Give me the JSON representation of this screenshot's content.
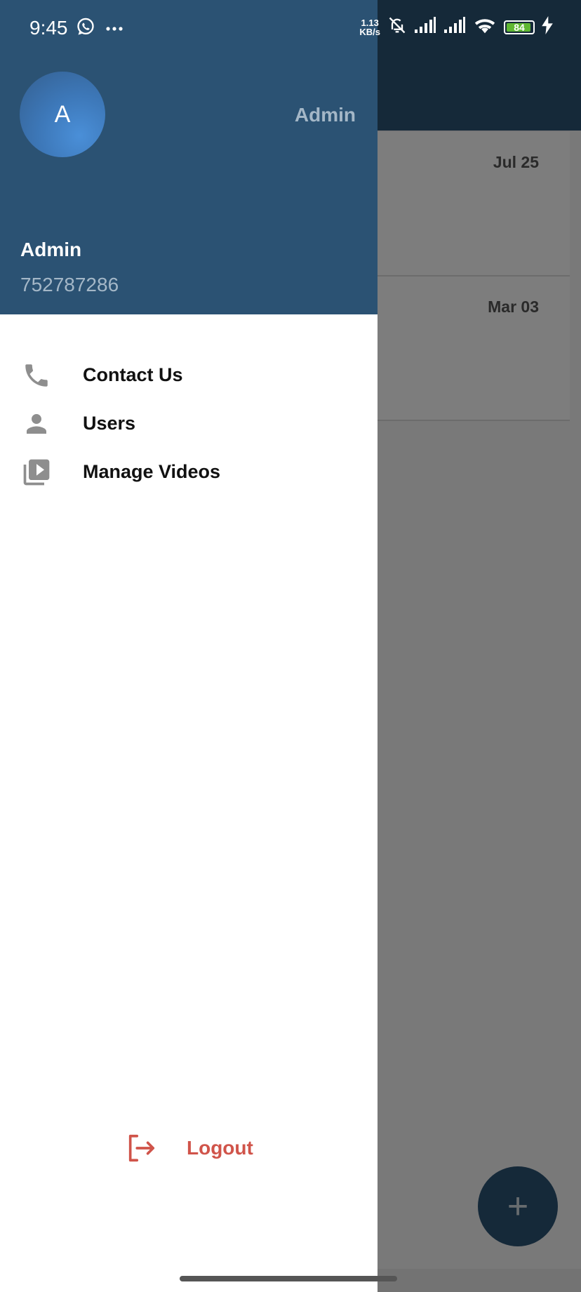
{
  "status_bar": {
    "time": "9:45",
    "net_speed_value": "1.13",
    "net_speed_unit": "KB/s",
    "battery_level": "84",
    "icons": [
      "whatsapp-icon",
      "more-dots-icon",
      "bell-off-icon",
      "signal-icon",
      "signal-icon",
      "wifi-icon",
      "charging-icon"
    ]
  },
  "drawer": {
    "avatar_letter": "A",
    "role": "Admin",
    "name": "Admin",
    "phone": "752787286",
    "menu": [
      {
        "label": "Contact Us",
        "icon": "phone-icon"
      },
      {
        "label": "Users",
        "icon": "person-icon"
      },
      {
        "label": "Manage Videos",
        "icon": "video-library-icon"
      }
    ],
    "logout_label": "Logout"
  },
  "background_list": {
    "items": [
      {
        "date": "Jul 25"
      },
      {
        "date": "Mar 03"
      }
    ],
    "fab_label": "+"
  },
  "colors": {
    "header": "#2b5273",
    "logout": "#d0544a",
    "battery": "#5fb832"
  }
}
